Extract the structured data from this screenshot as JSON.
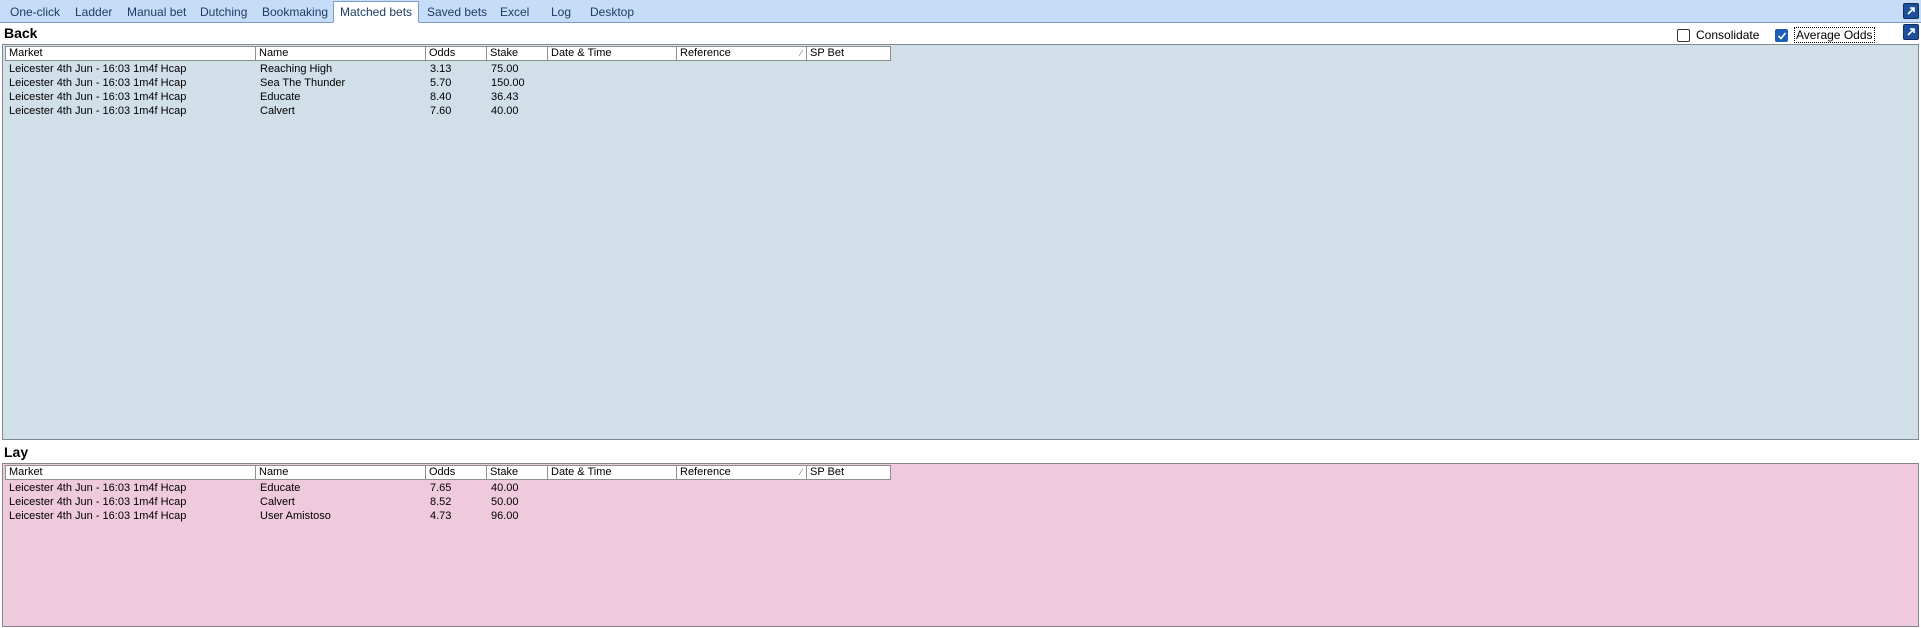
{
  "tabs": [
    "One-click",
    "Ladder",
    "Manual bet",
    "Dutching",
    "Bookmaking",
    "Matched bets",
    "Saved bets",
    "Excel",
    "Log",
    "Desktop"
  ],
  "active_tab": "Matched bets",
  "options": {
    "consolidate_label": "Consolidate",
    "consolidate_checked": false,
    "average_odds_label": "Average Odds",
    "average_odds_checked": true
  },
  "columns": [
    "Market",
    "Name",
    "Odds",
    "Stake",
    "Date & Time",
    "Reference",
    "SP Bet"
  ],
  "back": {
    "title": "Back",
    "rows": [
      {
        "market": "Leicester 4th Jun - 16:03 1m4f Hcap",
        "name": "Reaching High",
        "odds": "3.13",
        "stake": "75.00",
        "datetime": "",
        "reference": "",
        "sp": ""
      },
      {
        "market": "Leicester 4th Jun - 16:03 1m4f Hcap",
        "name": "Sea The Thunder",
        "odds": "5.70",
        "stake": "150.00",
        "datetime": "",
        "reference": "",
        "sp": ""
      },
      {
        "market": "Leicester 4th Jun - 16:03 1m4f Hcap",
        "name": "Educate",
        "odds": "8.40",
        "stake": "36.43",
        "datetime": "",
        "reference": "",
        "sp": ""
      },
      {
        "market": "Leicester 4th Jun - 16:03 1m4f Hcap",
        "name": "Calvert",
        "odds": "7.60",
        "stake": "40.00",
        "datetime": "",
        "reference": "",
        "sp": ""
      }
    ]
  },
  "lay": {
    "title": "Lay",
    "rows": [
      {
        "market": "Leicester 4th Jun - 16:03 1m4f Hcap",
        "name": "Educate",
        "odds": "7.65",
        "stake": "40.00",
        "datetime": "",
        "reference": "",
        "sp": ""
      },
      {
        "market": "Leicester 4th Jun - 16:03 1m4f Hcap",
        "name": "Calvert",
        "odds": "8.52",
        "stake": "50.00",
        "datetime": "",
        "reference": "",
        "sp": ""
      },
      {
        "market": "Leicester 4th Jun - 16:03 1m4f Hcap",
        "name": "User Amistoso",
        "odds": "4.73",
        "stake": "96.00",
        "datetime": "",
        "reference": "",
        "sp": ""
      }
    ]
  },
  "icons": {
    "float_window": "pop-out-arrow-icon",
    "sort": "sort-indicator-icon",
    "check": "checkmark-icon"
  },
  "colors": {
    "tabbar": "#c7dcf6",
    "back_panel": "#d1dfe9",
    "lay_panel": "#efcadc",
    "accent": "#1d4f9b"
  }
}
